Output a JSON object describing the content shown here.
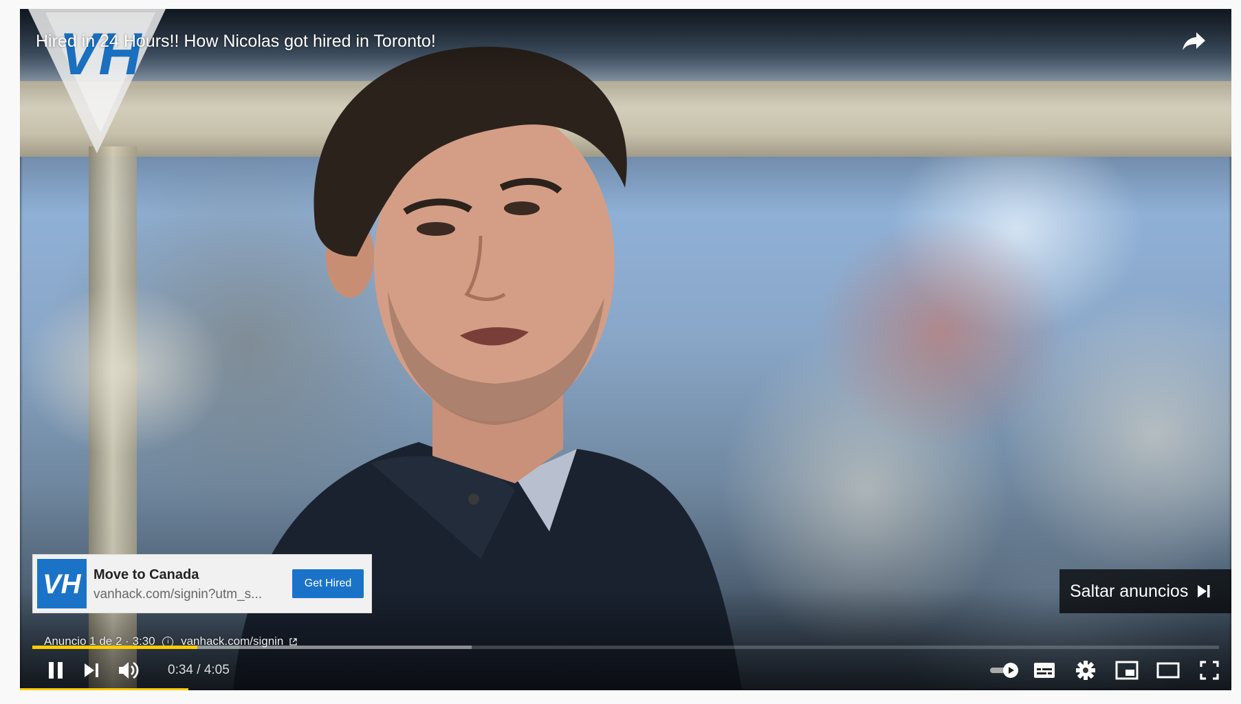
{
  "video": {
    "title": "Hired in 24 Hours!! How Nicolas got hired in Toronto!",
    "share_icon": "share-icon"
  },
  "ad_card": {
    "headline": "Move to Canada",
    "url": "vanhack.com/signin?utm_s...",
    "cta_label": "Get Hired"
  },
  "skip_ad": {
    "label": "Saltar anuncios",
    "icon": "skip-next-icon"
  },
  "ad_info": {
    "counter": "Anuncio 1 de 2 · 3:30",
    "link": "vanhack.com/signin"
  },
  "progress": {
    "played_fraction": 0.139,
    "buffered_fraction": 0.37
  },
  "controls": {
    "time": "0:34 / 4:05",
    "icons": [
      "pause-icon",
      "next-icon",
      "volume-icon",
      "autoplay-toggle-icon",
      "subtitles-icon",
      "settings-icon",
      "miniplayer-icon",
      "theater-mode-icon",
      "fullscreen-icon"
    ]
  },
  "colors": {
    "accent_yellow": "#ffcc00",
    "cta_blue": "#1a73c9",
    "brand_blue": "#1b73c8"
  }
}
